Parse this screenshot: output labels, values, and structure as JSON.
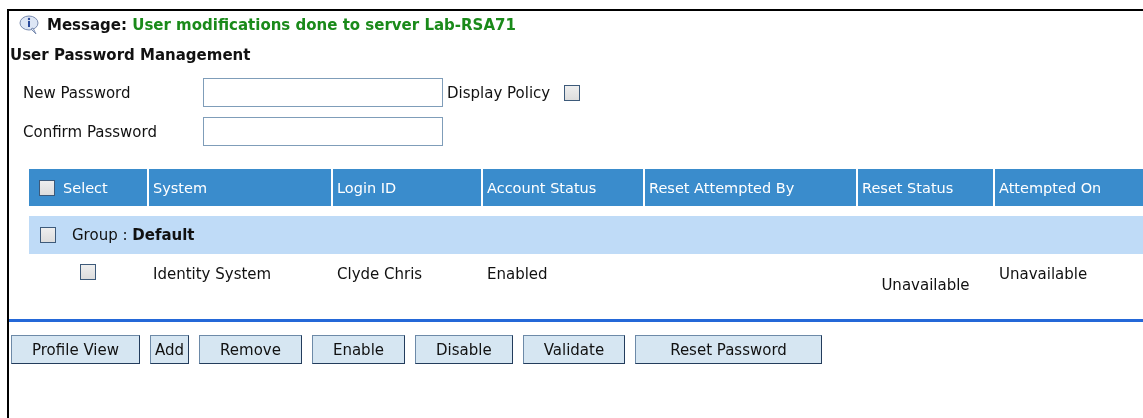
{
  "message": {
    "label": "Message:",
    "text": "User modifications done to server Lab-RSA71"
  },
  "title": "User Password Management",
  "fields": [
    {
      "label": "New Password"
    },
    {
      "label": "Confirm Password"
    }
  ],
  "display_policy": {
    "label": "Display Policy",
    "checked": false
  },
  "table": {
    "select_all": {
      "label": "Select",
      "checked": false
    },
    "columns": [
      "System",
      "Login ID",
      "Account Status",
      "Reset Attempted By",
      "Reset Status",
      "Attempted On"
    ],
    "group": {
      "label": "Group :",
      "name": "Default",
      "checked": false
    },
    "rows": [
      {
        "checked": false,
        "cells": [
          "Identity System",
          "Clyde Chris",
          "Enabled",
          null,
          "Unavailable",
          "Unavailable"
        ]
      }
    ]
  },
  "buttons": [
    "Profile View",
    "Add",
    "Remove",
    "Enable",
    "Disable",
    "Validate",
    "Reset Password"
  ]
}
